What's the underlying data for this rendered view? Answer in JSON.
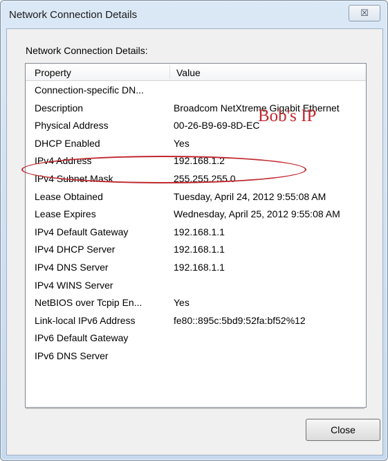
{
  "window": {
    "title": "Network Connection Details",
    "close_glyph": "☒"
  },
  "group": {
    "label": "Network Connection Details:"
  },
  "listview": {
    "columns": {
      "property": "Property",
      "value": "Value"
    },
    "rows": [
      {
        "property": "Connection-specific DN...",
        "value": ""
      },
      {
        "property": "Description",
        "value": "Broadcom NetXtreme Gigabit Ethernet"
      },
      {
        "property": "Physical Address",
        "value": "00-26-B9-69-8D-EC"
      },
      {
        "property": "DHCP Enabled",
        "value": "Yes"
      },
      {
        "property": "IPv4 Address",
        "value": "192.168.1.2"
      },
      {
        "property": "IPv4 Subnet Mask",
        "value": "255.255.255.0"
      },
      {
        "property": "Lease Obtained",
        "value": "Tuesday, April 24, 2012 9:55:08 AM"
      },
      {
        "property": "Lease Expires",
        "value": "Wednesday, April 25, 2012 9:55:08 AM"
      },
      {
        "property": "IPv4 Default Gateway",
        "value": "192.168.1.1"
      },
      {
        "property": "IPv4 DHCP Server",
        "value": "192.168.1.1"
      },
      {
        "property": "IPv4 DNS Server",
        "value": "192.168.1.1"
      },
      {
        "property": "IPv4 WINS Server",
        "value": ""
      },
      {
        "property": "NetBIOS over Tcpip En...",
        "value": "Yes"
      },
      {
        "property": "Link-local IPv6 Address",
        "value": "fe80::895c:5bd9:52fa:bf52%12"
      },
      {
        "property": "IPv6 Default Gateway",
        "value": ""
      },
      {
        "property": "IPv6 DNS Server",
        "value": ""
      }
    ]
  },
  "annotation": {
    "text": "Bob's IP",
    "color": "#c0282e"
  },
  "buttons": {
    "close_label": "Close"
  }
}
